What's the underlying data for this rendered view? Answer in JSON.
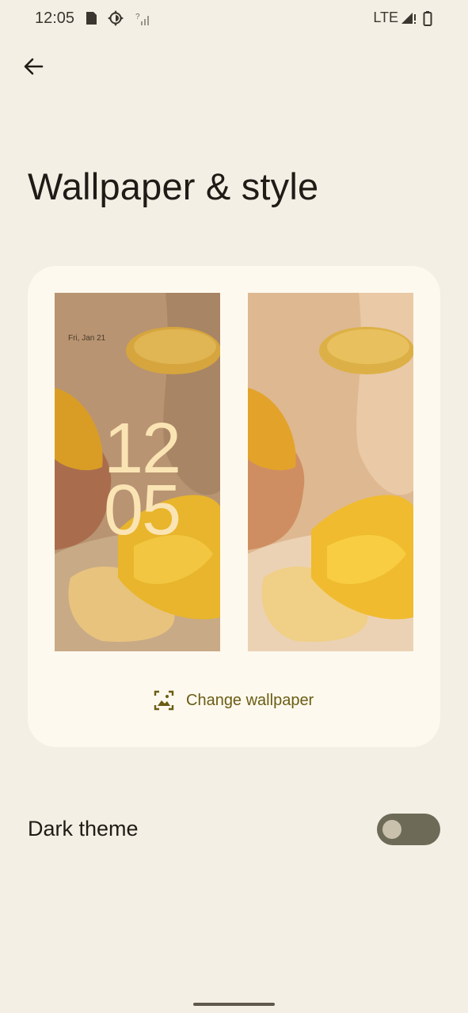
{
  "status_bar": {
    "time": "12:05",
    "network": "LTE",
    "icons_left": [
      "sd-card-icon",
      "brightness-icon",
      "signal-unknown-icon"
    ],
    "icons_right": [
      "signal-icon",
      "battery-icon"
    ]
  },
  "header": {
    "back_icon": "arrow-back-icon",
    "title": "Wallpaper & style"
  },
  "preview": {
    "lock_screen": {
      "date": "Fri, Jan 21",
      "clock_hour": "12",
      "clock_minute": "05"
    },
    "home_screen": {},
    "change_wallpaper_label": "Change wallpaper",
    "change_wallpaper_icon": "wallpaper-picture-icon"
  },
  "settings": {
    "dark_theme": {
      "label": "Dark theme",
      "enabled": false
    }
  },
  "colors": {
    "background": "#f4efe4",
    "card": "#fdf9ee",
    "accent_text": "#6b5c14",
    "toggle_track": "#6d6a58"
  }
}
